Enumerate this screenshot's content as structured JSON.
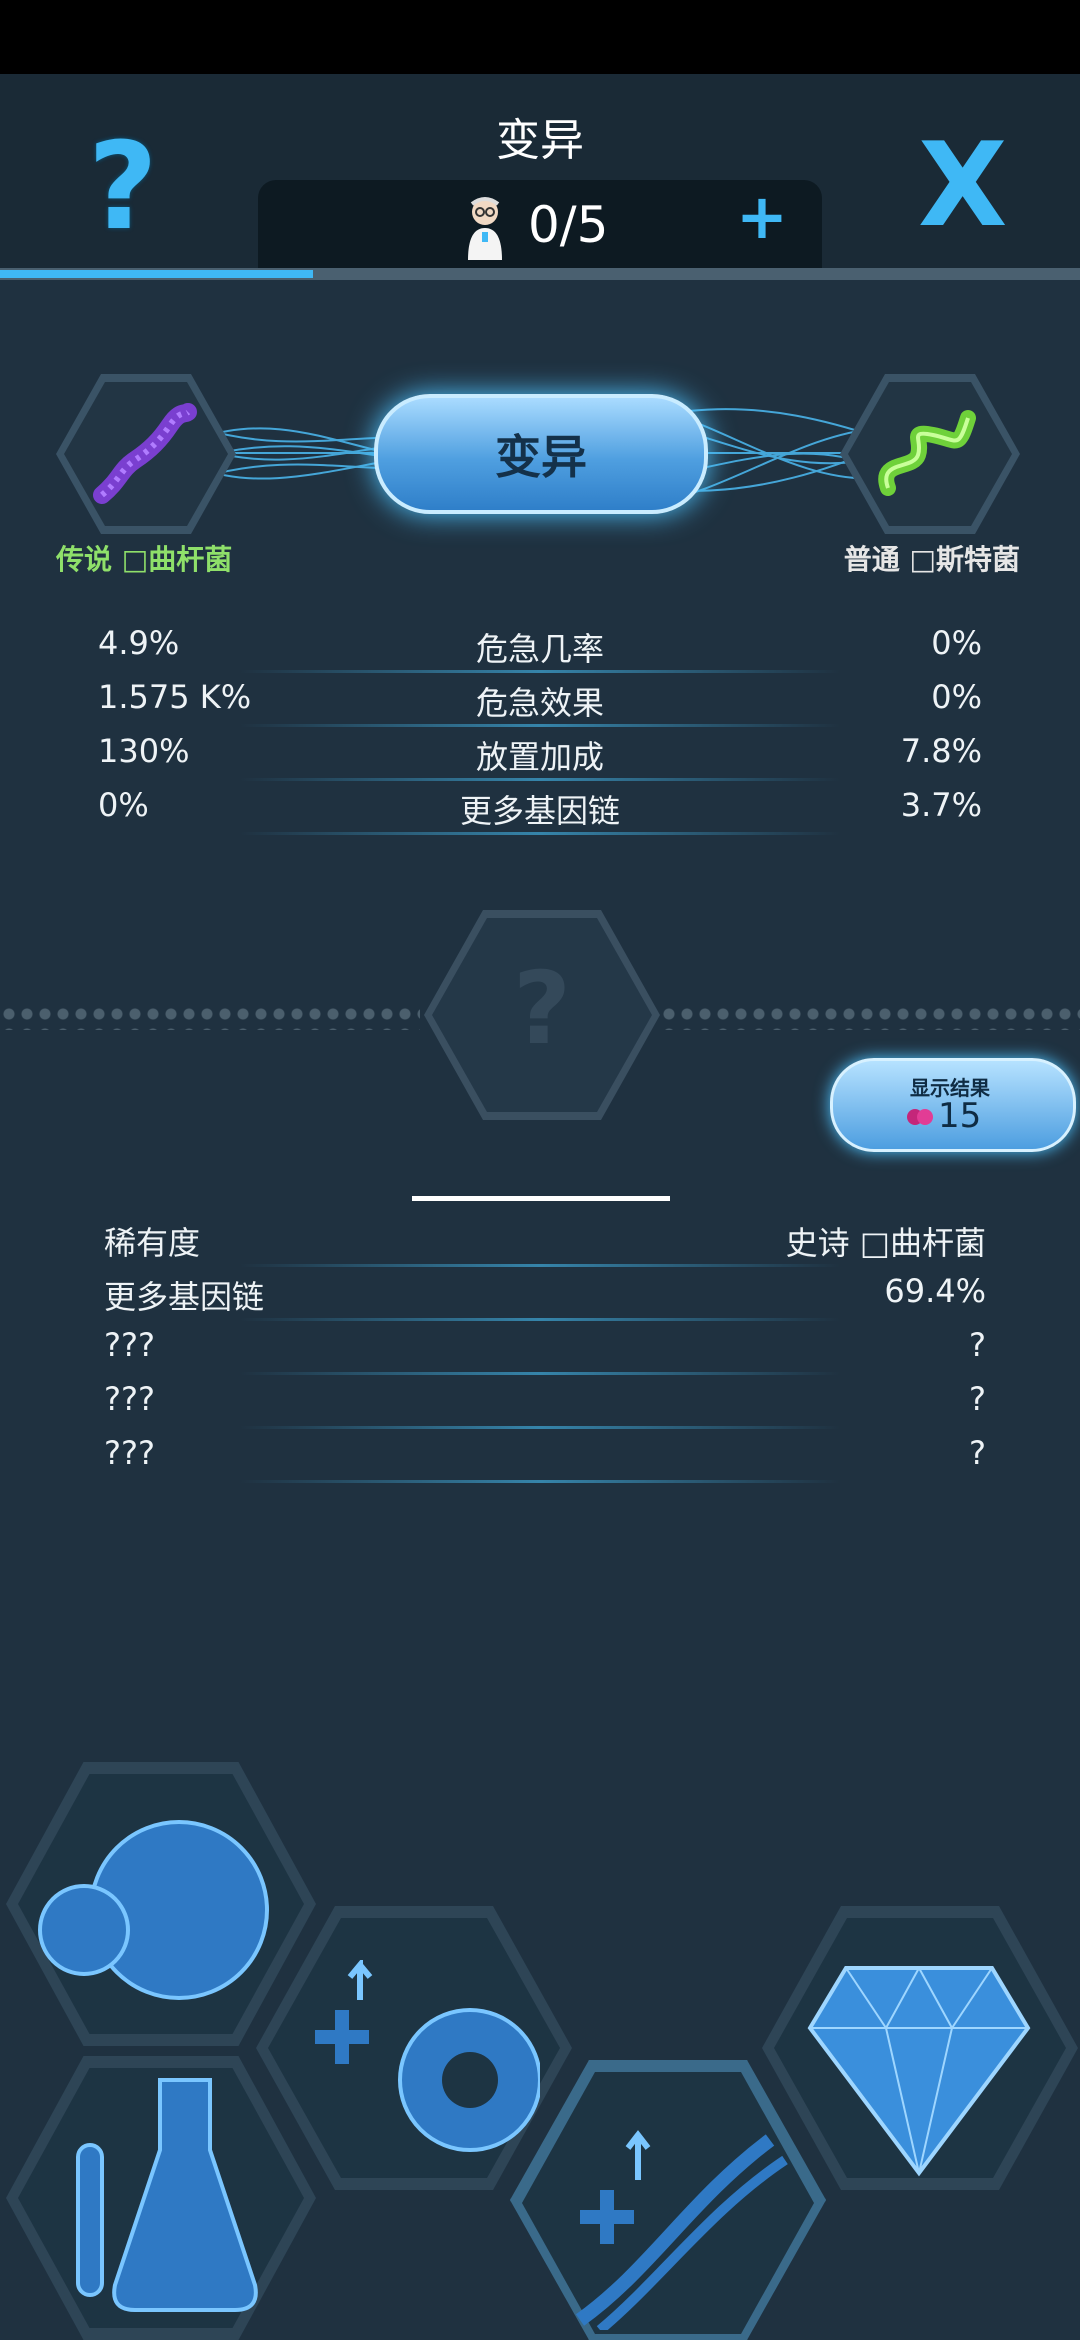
{
  "header": {
    "title": "变异",
    "counter": "0/5",
    "help_icon": "question-icon",
    "close_icon": "close-icon"
  },
  "progress": {
    "fraction": 0.29
  },
  "mutate": {
    "button_label": "变异",
    "left": {
      "rarity": "传说",
      "name": "□曲杆菌"
    },
    "right": {
      "rarity": "普通",
      "name": "□斯特菌"
    }
  },
  "stats": [
    {
      "left": "4.9%",
      "label": "危急几率",
      "right": "0%"
    },
    {
      "left": "1.575 K%",
      "label": "危急效果",
      "right": "0%"
    },
    {
      "left": "130%",
      "label": "放置加成",
      "right": "7.8%"
    },
    {
      "left": "0%",
      "label": "更多基因链",
      "right": "3.7%"
    }
  ],
  "result_slot": {
    "icon": "question-icon"
  },
  "show_result": {
    "label": "显示结果",
    "cost": "15"
  },
  "result_rows": [
    {
      "label": "稀有度",
      "value": "史诗 □曲杆菌"
    },
    {
      "label": "更多基因链",
      "value": "69.4%"
    },
    {
      "label": "???",
      "value": "?"
    },
    {
      "label": "???",
      "value": "?"
    },
    {
      "label": "???",
      "value": "?"
    }
  ],
  "colors": {
    "accent": "#3fb8f5",
    "legendary": "#8fe06a",
    "common": "#e6e6e6"
  },
  "bottom_nav": [
    "cells-icon",
    "flask-icon",
    "upgrade-gear-icon",
    "dna-upgrade-icon",
    "gem-icon"
  ]
}
